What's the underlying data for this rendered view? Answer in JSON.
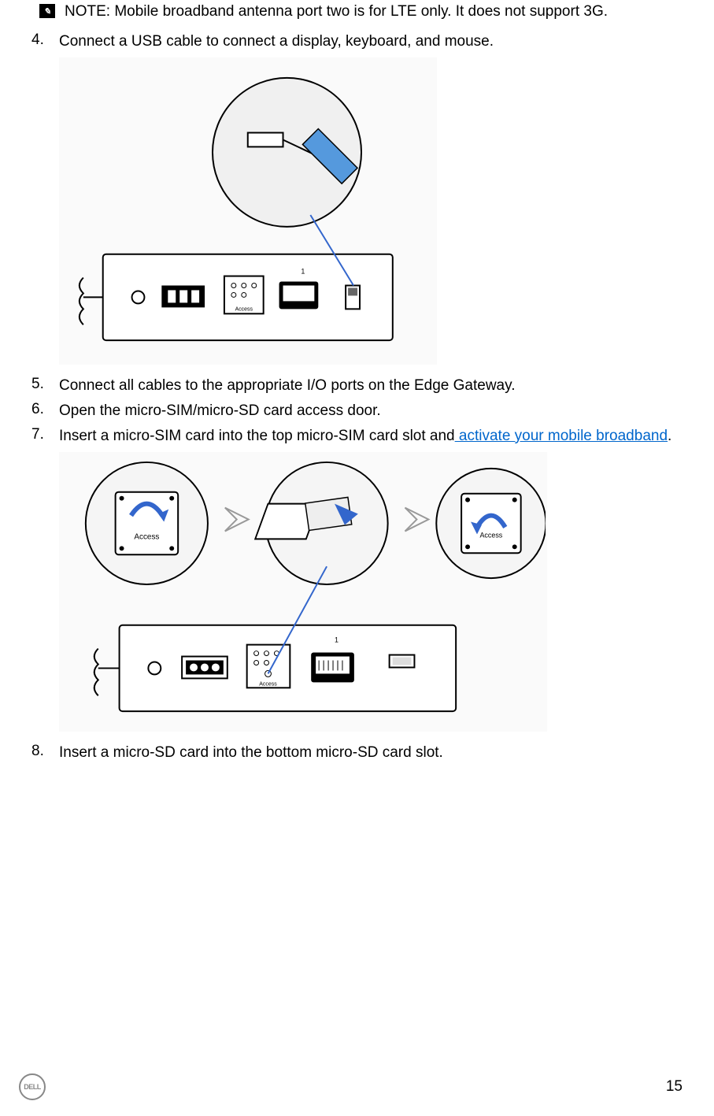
{
  "note": {
    "label": "NOTE:",
    "text": "Mobile broadband antenna port two is for LTE only. It does not support 3G."
  },
  "steps": {
    "s4": {
      "num": "4.",
      "text": "Connect a USB cable to connect a display, keyboard, and mouse."
    },
    "s5": {
      "num": "5.",
      "text": "Connect all cables to the appropriate I/O ports on the Edge Gateway."
    },
    "s6": {
      "num": "6.",
      "text": "Open the micro-SIM/micro-SD card access door."
    },
    "s7": {
      "num": "7.",
      "text_prefix": "Insert a micro-SIM card into the top micro-SIM card slot and",
      "link_text": " activate your mobile broadband",
      "text_suffix": "."
    },
    "s8": {
      "num": "8.",
      "text": "Insert a micro-SD card into the bottom micro-SD card slot."
    }
  },
  "figures": {
    "fig1": {
      "alt": "USB cable connection to Edge Gateway port panel illustration"
    },
    "fig2": {
      "alt": "Micro-SIM card insertion into access door illustration"
    }
  },
  "footer": {
    "logo_text": "DELL",
    "page_number": "15"
  }
}
